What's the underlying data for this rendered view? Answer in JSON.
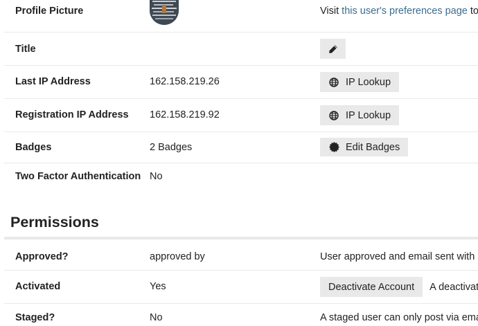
{
  "user_fields": {
    "profile_picture": {
      "label": "Profile Picture",
      "action_prefix": "Visit ",
      "action_link": "this user's preferences page",
      "action_suffix": " to c"
    },
    "title": {
      "label": "Title",
      "edit_icon": "pencil-icon"
    },
    "last_ip": {
      "label": "Last IP Address",
      "value": "162.158.219.26",
      "button_label": "IP Lookup",
      "button_icon": "globe-icon"
    },
    "registration_ip": {
      "label": "Registration IP Address",
      "value": "162.158.219.92",
      "button_label": "IP Lookup",
      "button_icon": "globe-icon"
    },
    "badges": {
      "label": "Badges",
      "value": "2 Badges",
      "button_label": "Edit Badges",
      "button_icon": "certificate-icon"
    },
    "two_factor": {
      "label": "Two Factor Authentication",
      "value": "No"
    }
  },
  "permissions": {
    "title": "Permissions",
    "approved": {
      "label": "Approved?",
      "value": "approved by",
      "note": "User approved and email sent with a"
    },
    "activated": {
      "label": "Activated",
      "value": "Yes",
      "button_label": "Deactivate Account",
      "note": "A deactivate"
    },
    "staged": {
      "label": "Staged?",
      "value": "No",
      "note": "A staged user can only post via emai"
    }
  },
  "colors": {
    "link": "#3a6c8f",
    "button_bg": "#e9e9e9",
    "border": "#e9e9e9",
    "text": "#222222"
  }
}
